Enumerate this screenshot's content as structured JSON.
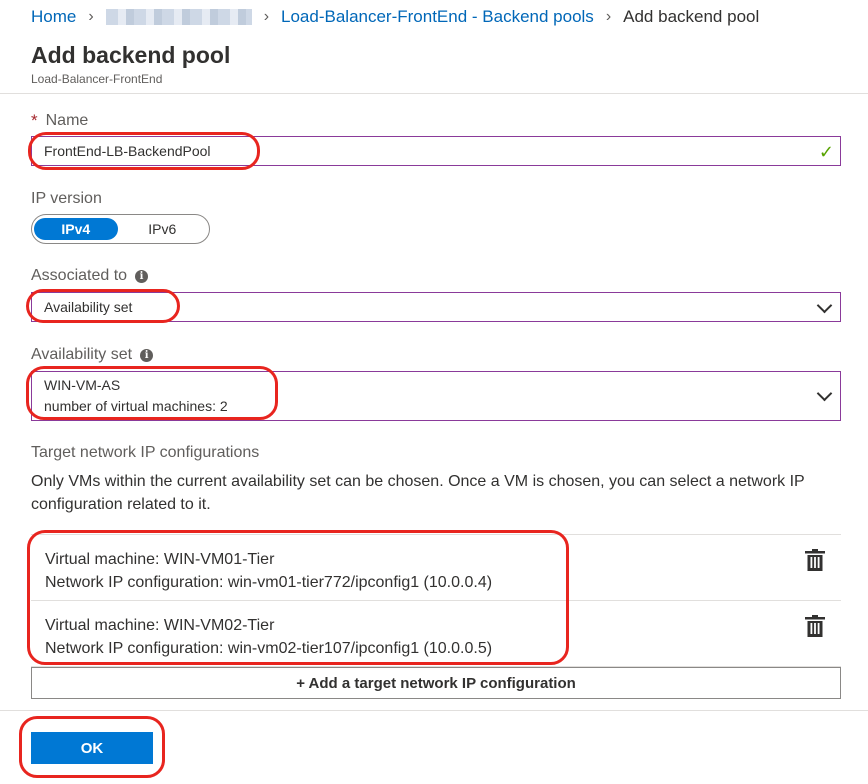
{
  "breadcrumb": {
    "home": "Home",
    "parent": "Load-Balancer-FrontEnd - Backend pools",
    "current": "Add backend pool"
  },
  "header": {
    "title": "Add backend pool",
    "subtitle": "Load-Balancer-FrontEnd"
  },
  "form": {
    "name": {
      "required_marker": "*",
      "label": "Name",
      "value": "FrontEnd-LB-BackendPool"
    },
    "ip_version": {
      "label": "IP version",
      "options": [
        "IPv4",
        "IPv6"
      ],
      "selected": "IPv4"
    },
    "associated_to": {
      "label": "Associated to",
      "value": "Availability set"
    },
    "availability_set": {
      "label": "Availability set",
      "name": "WIN-VM-AS",
      "detail": "number of virtual machines: 2"
    }
  },
  "target_configs": {
    "heading": "Target network IP configurations",
    "description": "Only VMs within the current availability set can be chosen. Once a VM is chosen, you can select a network IP configuration related to it.",
    "rows": [
      {
        "vm": "Virtual machine: WIN-VM01-Tier",
        "ip_config": "Network IP configuration: win-vm01-tier772/ipconfig1 (10.0.0.4)"
      },
      {
        "vm": "Virtual machine: WIN-VM02-Tier",
        "ip_config": "Network IP configuration: win-vm02-tier107/ipconfig1 (10.0.0.5)"
      }
    ],
    "add_label": "+ Add a target network IP configuration"
  },
  "footer": {
    "ok_label": "OK"
  },
  "colors": {
    "accent": "#0078d4",
    "link": "#0067b8",
    "valid_check": "#57a300",
    "annotation": "#e8251f"
  },
  "icons": [
    "chevron-right-icon",
    "info-icon",
    "check-icon",
    "chevron-down-icon",
    "trash-icon"
  ]
}
